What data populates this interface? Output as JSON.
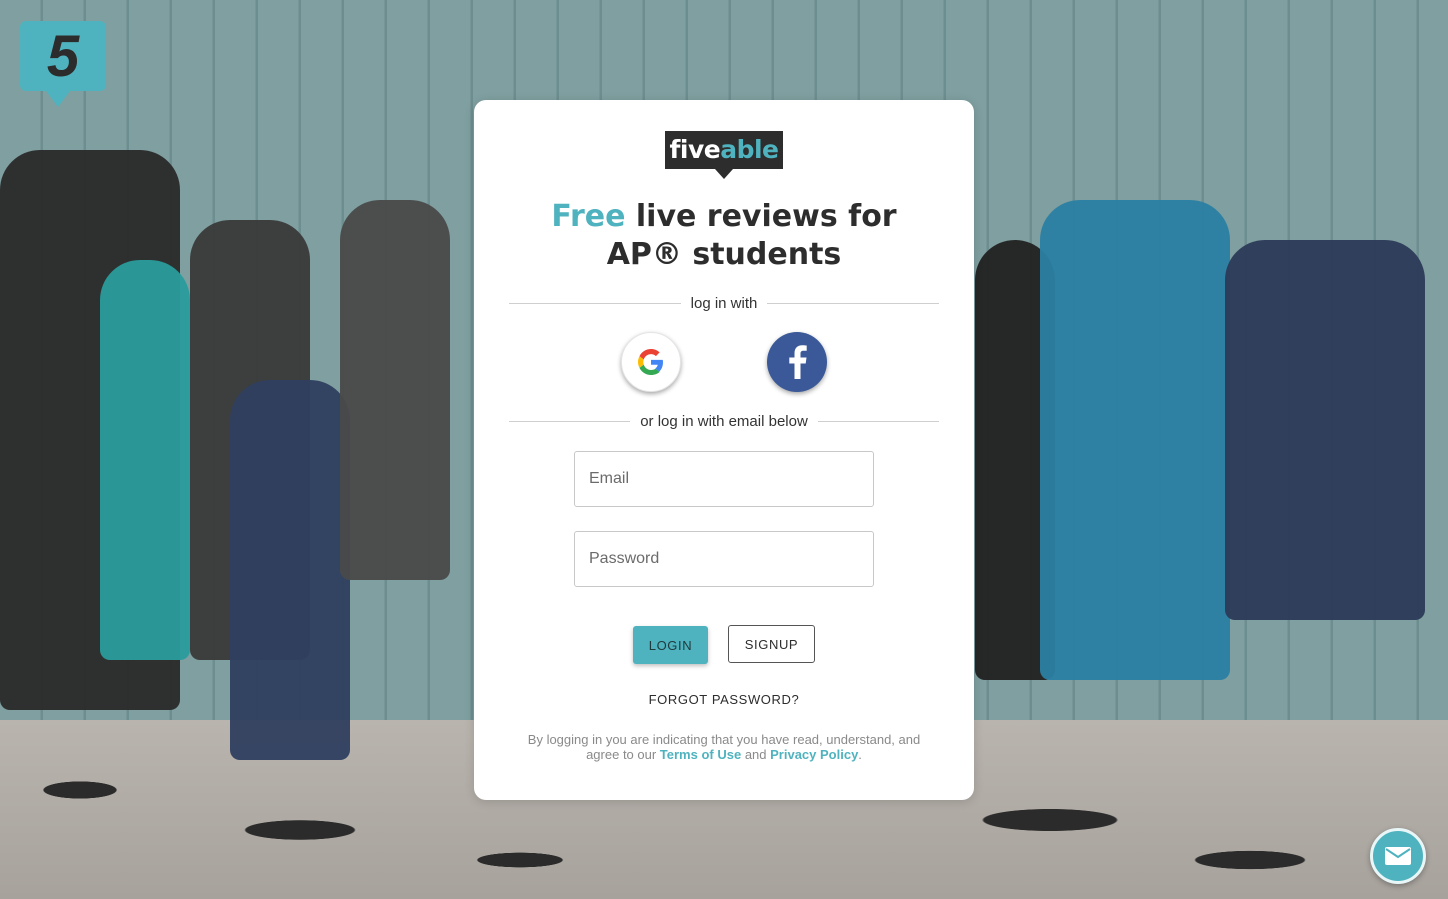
{
  "brand": {
    "badge_text": "5",
    "logo_part1": "five",
    "logo_part2": "able"
  },
  "headline": {
    "accent": "Free",
    "rest_line1": " live reviews for",
    "line2": "AP® students"
  },
  "social_divider": "log in with",
  "email_divider": "or log in with email below",
  "social": {
    "google_icon": "google-icon",
    "facebook_icon": "facebook-icon"
  },
  "form": {
    "email_placeholder": "Email",
    "password_placeholder": "Password"
  },
  "buttons": {
    "login": "LOGIN",
    "signup": "SIGNUP",
    "forgot": "FORGOT PASSWORD?"
  },
  "legal": {
    "prefix": "By logging in you are indicating that you have read, understand, and agree to our ",
    "terms": "Terms of Use",
    "middle": " and ",
    "privacy": "Privacy Policy",
    "suffix": "."
  },
  "colors": {
    "accent": "#4fb3bf",
    "dark": "#2d2d2d",
    "facebook": "#3b5998"
  }
}
